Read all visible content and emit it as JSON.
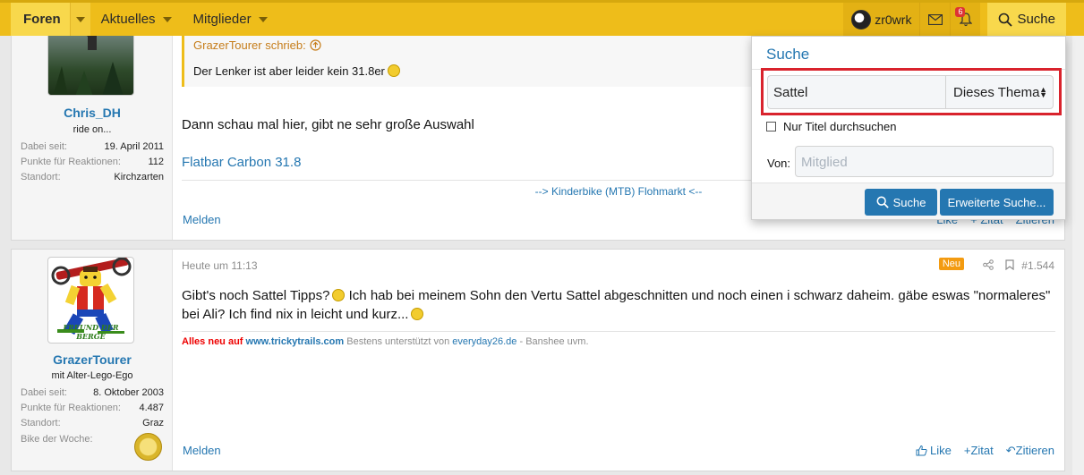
{
  "nav": {
    "tabs": [
      {
        "label": "Foren"
      },
      {
        "label": "Aktuelles"
      },
      {
        "label": "Mitglieder"
      }
    ],
    "username": "zr0wrk",
    "alerts_count": "6",
    "search_label": "Suche"
  },
  "post1": {
    "user": {
      "name": "Chris_DH",
      "title": "ride on...",
      "stats": [
        {
          "k": "Dabei seit:",
          "v": "19. April 2011"
        },
        {
          "k": "Punkte für Reaktionen:",
          "v": "112"
        },
        {
          "k": "Standort:",
          "v": "Kirchzarten"
        }
      ]
    },
    "quote_author": "GrazerTourer schrieb:",
    "quote_text": "Der Lenker ist aber leider kein 31.8er",
    "body": "Dann schau mal hier, gibt ne sehr große Auswahl",
    "link": "Flatbar Carbon 31.8",
    "signature": "--> Kinderbike (MTB) Flohmarkt <--",
    "report": "Melden",
    "actions": {
      "like": "Like",
      "reply": "+ Zitat",
      "quote": "Zitieren"
    }
  },
  "post2": {
    "user": {
      "name": "GrazerTourer",
      "title": "mit Alter-Lego-Ego",
      "avatar_caption": "FREUND DER BERGE",
      "stats": [
        {
          "k": "Dabei seit:",
          "v": "8. Oktober 2003"
        },
        {
          "k": "Punkte für Reaktionen:",
          "v": "4.487"
        },
        {
          "k": "Standort:",
          "v": "Graz"
        },
        {
          "k": "Bike der Woche:",
          "v": ""
        }
      ]
    },
    "time": "Heute um 11:13",
    "new_badge": "Neu",
    "number": "#1.544",
    "body_1": "Gibt's noch Sattel Tipps?",
    "body_2": "Ich hab bei meinem Sohn den Vertu Sattel abgeschnitten und noch einen i schwarz daheim. gäbe eswas \"normaleres\"",
    "body_3": "bei Ali? Ich find nix in leicht und kurz...",
    "sig_red": "Alles neu auf",
    "sig_link1": "www.trickytrails.com",
    "sig_mid": "Bestens unterstützt von",
    "sig_link2": "everyday26.de",
    "sig_end": "- Banshee uvm.",
    "report": "Melden",
    "actions": {
      "like": "Like",
      "reply": "Zitat",
      "quote": "Zitieren"
    }
  },
  "search_menu": {
    "title": "Suche",
    "query": "Sattel",
    "scope": "Dieses Thema",
    "titles_only": "Nur Titel durchsuchen",
    "from_label": "Von:",
    "member_placeholder": "Mitglied",
    "search_button": "Suche",
    "advanced_button": "Erweiterte Suche..."
  }
}
